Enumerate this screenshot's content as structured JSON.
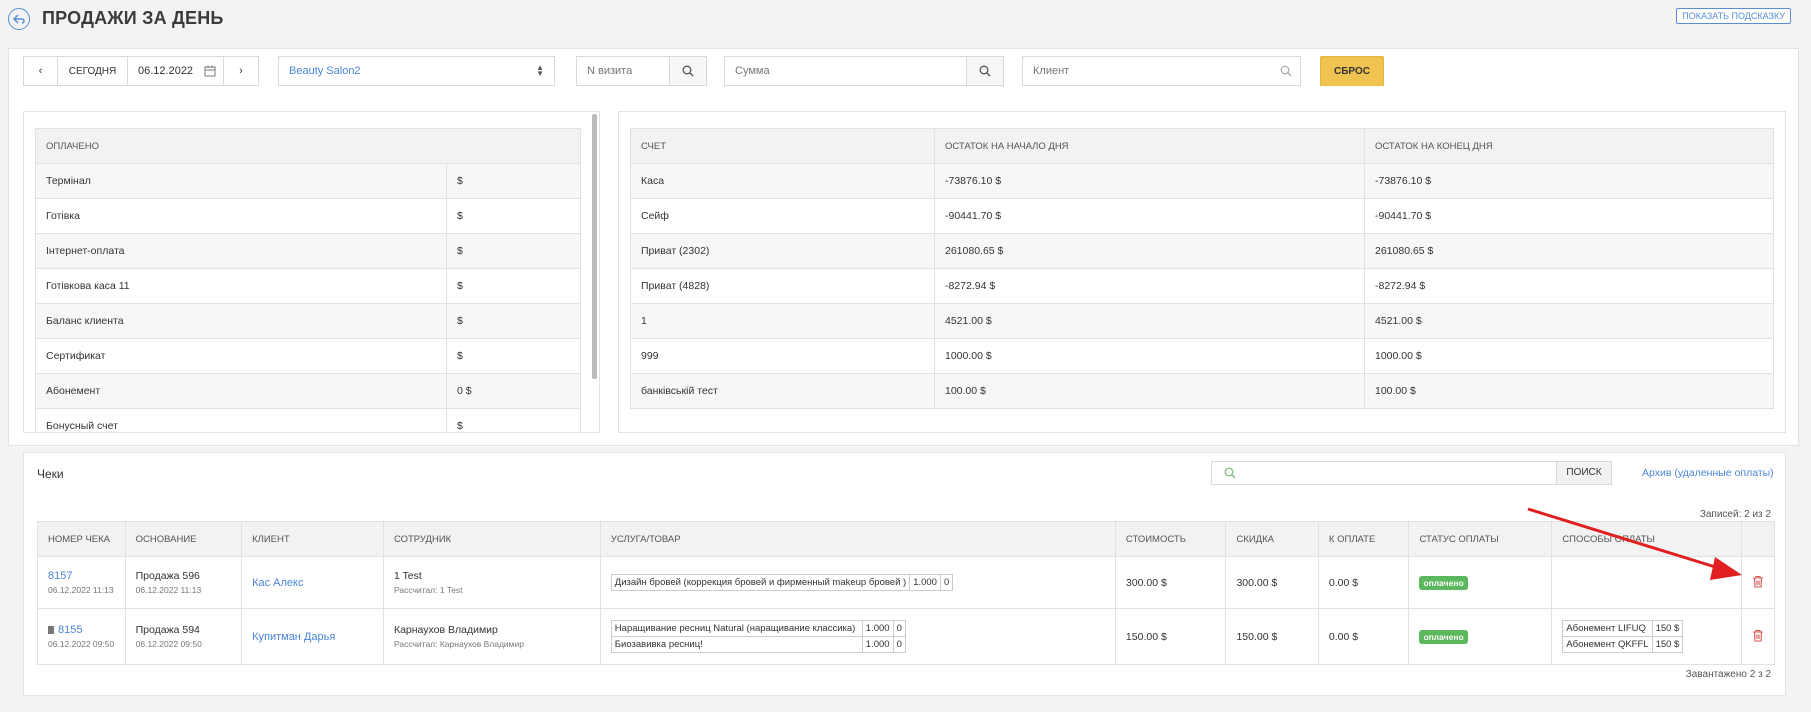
{
  "header": {
    "title": "ПРОДАЖИ ЗА ДЕНЬ",
    "hint_label": "ПОКАЗАТЬ ПОДСКАЗКУ"
  },
  "filters": {
    "today_label": "СЕГОДНЯ",
    "date_value": "06.12.2022",
    "salon_value": "Beauty Salon2",
    "visit_placeholder": "N визита",
    "sum_placeholder": "Сумма",
    "client_placeholder": "Клиент",
    "reset_label": "СБРОС"
  },
  "paid": {
    "header": "ОПЛАЧЕНО",
    "rows": [
      {
        "name": "Термінал",
        "value": "$"
      },
      {
        "name": "Готівка",
        "value": "$"
      },
      {
        "name": "Інтернет-оплата",
        "value": "$"
      },
      {
        "name": "Готівкова каса 11",
        "value": "$"
      },
      {
        "name": "Баланс клиента",
        "value": "$"
      },
      {
        "name": "Сертификат",
        "value": "$"
      },
      {
        "name": "Абонемент",
        "value": "0 $"
      },
      {
        "name": "Бонусный счет",
        "value": "$"
      }
    ]
  },
  "accounts": {
    "headers": [
      "СЧЕТ",
      "ОСТАТОК НА НАЧАЛО ДНЯ",
      "ОСТАТОК НА КОНЕЦ ДНЯ"
    ],
    "rows": [
      [
        "Каса",
        "-73876.10 $",
        "-73876.10 $"
      ],
      [
        "Сейф",
        "-90441.70 $",
        "-90441.70 $"
      ],
      [
        "Приват (2302)",
        "261080.65 $",
        "261080.65 $"
      ],
      [
        "Приват (4828)",
        "-8272.94 $",
        "-8272.94 $"
      ],
      [
        "1",
        "4521.00 $",
        "4521.00 $"
      ],
      [
        "999",
        "1000.00 $",
        "1000.00 $"
      ],
      [
        "банківській тест",
        "100.00 $",
        "100.00 $"
      ]
    ]
  },
  "checks": {
    "title": "Чеки",
    "search_button": "ПОИСК",
    "archive_link": "Архив (удаленные оплаты)",
    "records": "Записей: 2 из 2",
    "loaded": "Завантажено 2 з 2",
    "headers": [
      "НОМЕР ЧЕКА",
      "ОСНОВАНИЕ",
      "КЛИЕНТ",
      "СОТРУДНИК",
      "УСЛУГА/ТОВАР",
      "СТОИМОСТЬ",
      "СКИДКА",
      "К ОПЛАТЕ",
      "СТАТУС ОПЛАТЫ",
      "СПОСОБЫ ОПЛАТЫ"
    ],
    "rows": [
      {
        "number": "8157",
        "number_date": "06.12.2022 11:13",
        "basis": "Продажа 596",
        "basis_date": "06.12.2022 11:13",
        "client": "Кас Алекс",
        "employee": "1 Test",
        "employee_sub": "Рассчитал: 1 Test",
        "items": [
          {
            "name": "Дизайн бровей (коррекция бровей и фирменный makeup бровей )",
            "qty": "1.000",
            "disc": "0"
          }
        ],
        "cost": "300.00 $",
        "discount": "300.00 $",
        "to_pay": "0.00 $",
        "status": "оплачено",
        "methods": []
      },
      {
        "number": "8155",
        "number_date": "06.12.2022 09:50",
        "basis": "Продажа 594",
        "basis_date": "06.12.2022 09:50",
        "client": "Купитман Дарья",
        "employee": "Карнаухов Владимир",
        "employee_sub": "Рассчитал: Карнаухов Владимир",
        "items": [
          {
            "name": "Наращивание ресниц Natural (наращивание классика)",
            "qty": "1.000",
            "disc": "0"
          },
          {
            "name": "Биозавивка ресниц!",
            "qty": "1.000",
            "disc": "0"
          }
        ],
        "cost": "150.00 $",
        "discount": "150.00 $",
        "to_pay": "0.00 $",
        "status": "оплачено",
        "methods": [
          {
            "name": "Абонемент LIFUQ",
            "amount": "150 $"
          },
          {
            "name": "Абонемент QKFFL",
            "amount": "150 $"
          }
        ]
      }
    ]
  },
  "colors": {
    "accent": "#4a86d8",
    "reset": "#f0c24f",
    "paid_badge": "#5cb85c",
    "trash": "#d9534f",
    "arrow": "#e02020"
  }
}
